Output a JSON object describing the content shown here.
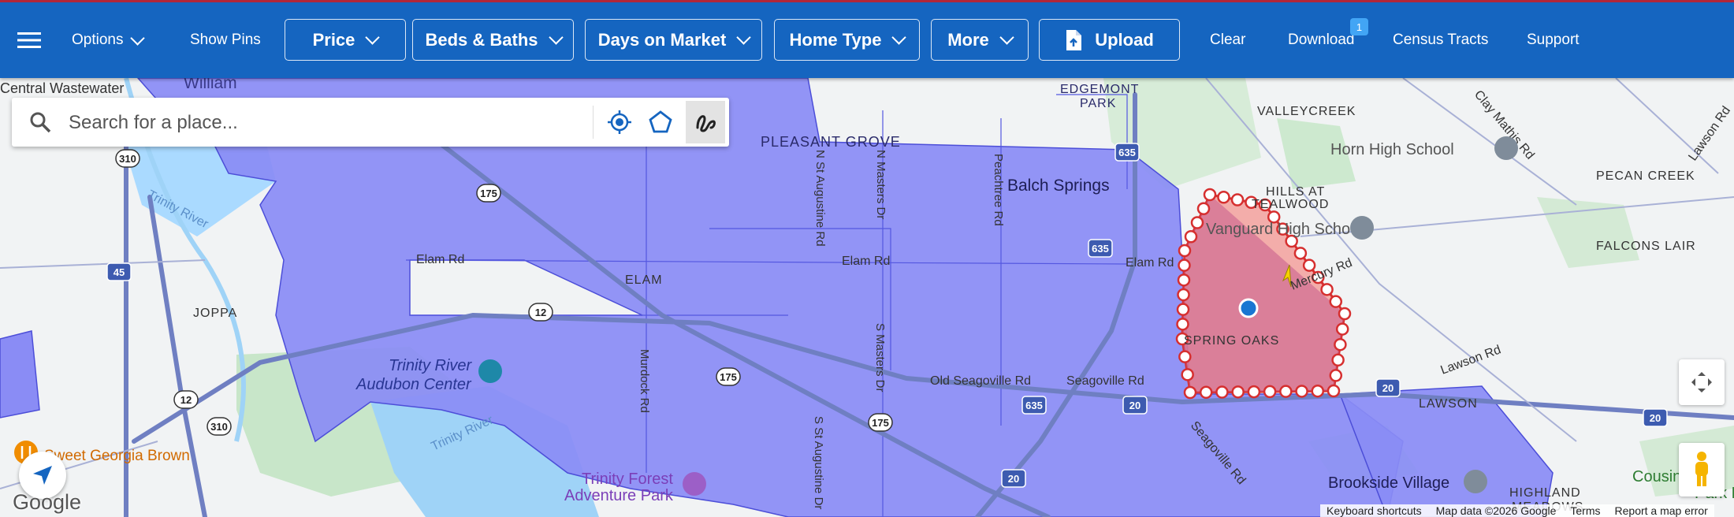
{
  "toolbar": {
    "options_label": "Options",
    "show_pins_label": "Show Pins",
    "price_label": "Price",
    "beds_baths_label": "Beds & Baths",
    "days_on_market_label": "Days on Market",
    "home_type_label": "Home Type",
    "more_label": "More",
    "upload_label": "Upload",
    "clear_label": "Clear",
    "download_label": "Download",
    "download_badge": "1",
    "census_tracts_label": "Census Tracts",
    "support_label": "Support"
  },
  "search": {
    "placeholder": "Search for a place..."
  },
  "map": {
    "labels": {
      "central_wastewater": "Central Wastewater",
      "william": "William",
      "pleasant_grove": "PLEASANT GROVE",
      "edgemont_park": "EDGEMONT",
      "edgemont_park2": "PARK",
      "valleycreek": "VALLEYCREEK",
      "horn_high_school": "Horn High School",
      "clay_mathis_rd": "Clay Mathis Rd",
      "lawson_rd_ne": "Lawson Rd",
      "pecan_creek": "PECAN CREEK",
      "hills_at": "HILLS AT",
      "tealwood": "TEALWOOD",
      "vanguard": "Vanguard High School",
      "falcons_lair": "FALCONS LAIR",
      "balch_springs": "Balch Springs",
      "trinity_river_nw": "Trinity River",
      "elam_rd_w": "Elam Rd",
      "elam": "ELAM",
      "elam_rd_c": "Elam Rd",
      "elam_rd_e": "Elam Rd",
      "mercury_rd": "Mercury Rd",
      "joppa": "JOPPA",
      "n_st_augustine": "N St Augustine Rd",
      "n_masters": "N Masters Dr",
      "peachtree": "Peachtree Rd",
      "spring_oaks": "SPRING OAKS",
      "lawson_rd": "Lawson Rd",
      "lawson": "LAWSON",
      "trinity_audubon": "Trinity River",
      "trinity_audubon2": "Audubon Center",
      "murdock_rd": "Murdock Rd",
      "s_masters": "S Masters Dr",
      "old_seagoville": "Old Seagoville Rd",
      "seagoville_rd": "Seagoville Rd",
      "seagoville_rd2": "Seagoville Rd",
      "trinity_river_s": "Trinity River",
      "sweet_georgia": "Sweet Georgia Brown",
      "s_st_augustine": "S St Augustine Dr",
      "trinity_forest": "Trinity Forest",
      "trinity_forest2": "Adventure Park",
      "brookside": "Brookside Village",
      "highland": "HIGHLAND",
      "meadows": "MEADOWS",
      "cousins": "Cousin",
      "park": "Park D"
    },
    "shields": [
      "175",
      "310",
      "45",
      "12",
      "175",
      "635",
      "635",
      "175",
      "20",
      "20",
      "20",
      "12",
      "310",
      "635",
      "20"
    ],
    "attribution": {
      "keyboard": "Keyboard shortcuts",
      "mapdata": "Map data ©2026 Google",
      "terms": "Terms",
      "report": "Report a map error"
    },
    "logo": "Google",
    "colors": {
      "tract_fill": "#8a8cf5",
      "selection_fill": "#f2a0a0",
      "toolbar": "#1565c0"
    }
  }
}
